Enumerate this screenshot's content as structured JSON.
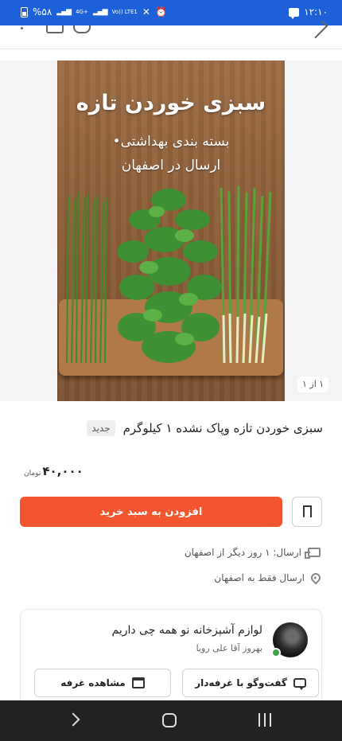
{
  "status_bar": {
    "time": "۱۲:۱۰",
    "battery": "%۵۸",
    "network": "4G+",
    "volte": "Vo))\nLTE1"
  },
  "gallery": {
    "image_title": "سبزی خوردن تازه",
    "image_subtitle_1": "بسته بندی بهداشتی•",
    "image_subtitle_2": "ارسال در اصفهان",
    "counter": "۱ از ۱"
  },
  "product": {
    "title": "سبزی خوردن تازه وپاک نشده ۱ کیلوگرم",
    "badge": "جدید",
    "price": "۴۰,۰۰۰",
    "currency": "تومان"
  },
  "actions": {
    "add_to_cart": "افزودن به سبد خرید",
    "bookmark_icon": "bookmark-icon"
  },
  "shipping": {
    "delivery": "ارسال: ۱ روز دیگر از اصفهان",
    "area": "ارسال فقط به اصفهان"
  },
  "shop": {
    "name": "لوازم آشپزخانه نو همه چی داریم",
    "owner": "بهروز آقا علی رویا",
    "chat_button": "گفت‌وگو با غرفه‌دار",
    "view_shop_button": "مشاهده غرفه"
  },
  "colors": {
    "status_bar": "#1e60d8",
    "primary_button": "#f3552e",
    "online": "#3fa34d",
    "nav_bar": "#222222"
  }
}
